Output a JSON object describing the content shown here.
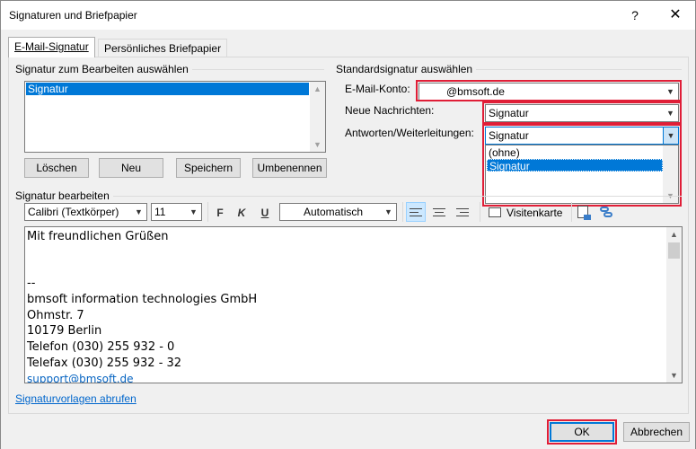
{
  "window": {
    "title": "Signaturen und Briefpapier",
    "help": "?",
    "close": "✕"
  },
  "tabs": [
    {
      "label": "E-Mail-Signatur"
    },
    {
      "label": "Persönliches Briefpapier"
    }
  ],
  "select_signature": {
    "label": "Signatur zum Bearbeiten auswählen",
    "items": [
      "Signatur"
    ],
    "buttons": {
      "delete": "Löschen",
      "new": "Neu",
      "save": "Speichern",
      "rename": "Umbenennen"
    }
  },
  "default_signature": {
    "label": "Standardsignatur auswählen",
    "account_label": "E-Mail-Konto:",
    "account_value": "@bmsoft.de",
    "new_messages_label": "Neue Nachrichten:",
    "new_messages_value": "Signatur",
    "replies_label": "Antworten/Weiterleitungen:",
    "replies_value": "Signatur",
    "replies_options": [
      "(ohne)",
      "Signatur"
    ]
  },
  "edit_signature": {
    "label": "Signatur bearbeiten",
    "font": "Calibri (Textkörper)",
    "size": "11",
    "bold": "F",
    "italic": "K",
    "underline": "U",
    "color": "Automatisch",
    "business_card": "Visitenkarte",
    "lines": [
      "Mit freundlichen Grüßen",
      "",
      "",
      "--",
      "bmsoft information technologies GmbH",
      "Ohmstr. 7",
      "10179 Berlin",
      "Telefon (030) 255 932 - 0",
      "Telefax (030) 255 932 - 32",
      "support@bmsoft.de"
    ]
  },
  "footer": {
    "templates_link": "Signaturvorlagen abrufen",
    "ok": "OK",
    "cancel": "Abbrechen"
  },
  "colors": {
    "accent": "#0078d7",
    "highlight": "#e01e37",
    "link": "#0066cc"
  }
}
